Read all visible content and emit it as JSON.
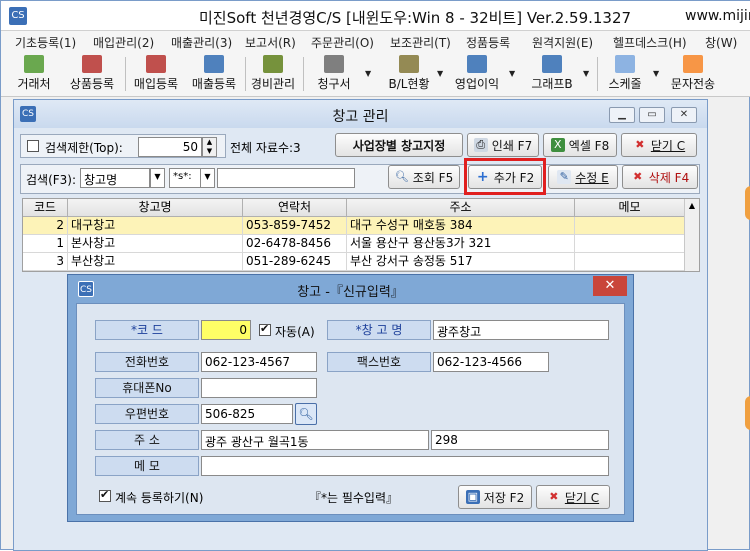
{
  "app": {
    "title": "미진Soft 천년경영C/S [내윈도우:Win 8 - 32비트] Ver.2.59.1327",
    "url": "www.mijin",
    "logo_text": "CS"
  },
  "menu": [
    "기초등록(1)",
    "매입관리(2)",
    "매출관리(3)",
    "보고서(R)",
    "주문관리(O)",
    "보조관리(T)",
    "정품등록",
    "원격지원(E)",
    "헬프데스크(H)",
    "창(W)"
  ],
  "toolbar": {
    "items": [
      {
        "label": "거래처",
        "icon": "customer-icon",
        "color": "#6aa84f"
      },
      {
        "label": "상품등록",
        "icon": "product-box-icon",
        "color": "#c0504d"
      },
      {
        "label": "매입등록",
        "icon": "purchase-icon",
        "color": "#c0504d"
      },
      {
        "label": "매출등록",
        "icon": "sales-icon",
        "color": "#4f81bd"
      },
      {
        "label": "경비관리",
        "icon": "expense-icon",
        "color": "#76923c"
      },
      {
        "label": "청구서",
        "icon": "invoice-icon",
        "color": "#7f7f7f"
      },
      {
        "label": "B/L현황",
        "icon": "bl-status-icon",
        "color": "#948a54"
      },
      {
        "label": "영업이익",
        "icon": "profit-icon",
        "color": "#4f81bd"
      },
      {
        "label": "그래프B",
        "icon": "graph-icon",
        "color": "#4f81bd"
      },
      {
        "label": "스케줄",
        "icon": "schedule-icon",
        "color": "#8db3e2"
      },
      {
        "label": "문자전송",
        "icon": "sms-icon",
        "color": "#f79646"
      }
    ]
  },
  "child": {
    "title": "창고 관리",
    "logo_text": "CS",
    "search_limit_label": "검색제한(Top):",
    "search_limit_value": "50",
    "total_label": "전체 자료수:3",
    "site_btn": "사업장별 창고지정",
    "print_btn": "인쇄 F7",
    "excel_btn": "엑셀 F8",
    "close_btn": "닫기 C",
    "search_label": "검색(F3):",
    "search_field": "창고명",
    "search_mode": "*s*:",
    "search_value": "",
    "find_btn": "조회 F5",
    "add_btn": "추가 F2",
    "edit_btn": "수정 E",
    "delete_btn": "삭제 F4"
  },
  "grid": {
    "columns": [
      "코드",
      "창고명",
      "연락처",
      "주소",
      "메모"
    ],
    "rows": [
      {
        "code": "2",
        "name": "대구창고",
        "phone": "053-859-7452",
        "address": "대구 수성구 매호동 384",
        "memo": ""
      },
      {
        "code": "1",
        "name": "본사창고",
        "phone": "02-6478-8456",
        "address": "서울 용산구 용산동3가 321",
        "memo": ""
      },
      {
        "code": "3",
        "name": "부산창고",
        "phone": "051-289-6245",
        "address": "부산 강서구 송정동 517",
        "memo": ""
      }
    ],
    "selected_color": "#fdf3b8"
  },
  "dialog": {
    "title": "창고 -『신규입력』",
    "close_glyph": "✕",
    "code_label": "*코 드",
    "code_value": "0",
    "auto_label": "자동(A)",
    "name_label": "*창 고 명",
    "name_value": "광주창고",
    "phone_label": "전화번호",
    "phone_value": "062-123-4567",
    "fax_label": "팩스번호",
    "fax_value": "062-123-4566",
    "mobile_label": "휴대폰No",
    "mobile_value": "",
    "zip_label": "우편번호",
    "zip_value": "506-825",
    "addr_label": "주 소",
    "addr_value1": "광주 광산구 월곡1동",
    "addr_value2": "298",
    "memo_label": "메 모",
    "memo_value": "",
    "continue_label": "계속 등록하기(N)",
    "required_note": "『*는 필수입력』",
    "save_btn": "저장 F2",
    "close_btn": "닫기 C"
  },
  "colors": {
    "highlight": "#e02020",
    "required_field_bg": "#ffff66"
  }
}
